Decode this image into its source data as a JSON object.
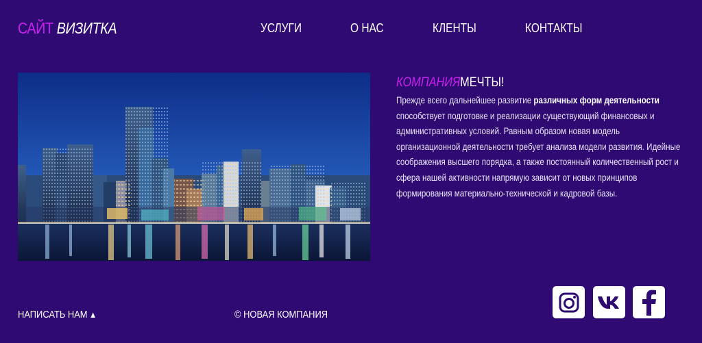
{
  "header": {
    "logo_accent": "САЙТ",
    "logo_main": "ВИЗИТКА",
    "nav": [
      {
        "label": "УСЛУГИ"
      },
      {
        "label": "О НАС"
      },
      {
        "label": "КЛЕНТЫ"
      },
      {
        "label": "КОНТАКТЫ"
      }
    ]
  },
  "about": {
    "title_accent": "КОМПАНИЯ",
    "title_main": "МЕЧТЫ!",
    "text_before": "Прежде всего дальнейшее развитие ",
    "text_bold": "различных форм деятельности",
    "text_after": " способствует подготовке и реализации существующий финансовых и административных условий. Равным образом новая модель организационной деятельности требует анализа модели развития. Идейные соображения высшего порядка, а также постоянный количественный рост и сфера нашей активности напрямую зависит от новых принципов формирования материально-технической и кадровой базы."
  },
  "footer": {
    "write_label": "НАПИСАТЬ НАМ",
    "write_arrow": "▲",
    "copyright": "© НОВАЯ КОМПАНИЯ"
  },
  "social": [
    {
      "icon": "instagram-icon"
    },
    {
      "icon": "vk-icon"
    },
    {
      "icon": "facebook-icon"
    }
  ],
  "colors": {
    "background": "#2e0a72",
    "accent": "#ca20f0",
    "text": "#ffffff"
  }
}
